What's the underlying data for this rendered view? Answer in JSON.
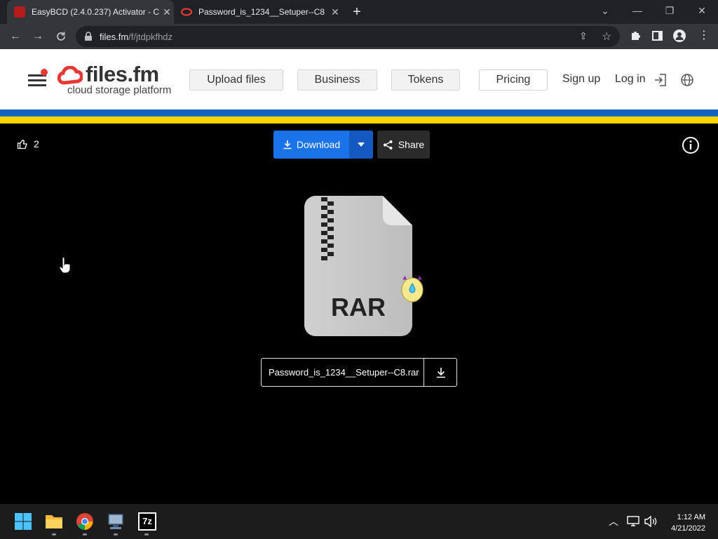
{
  "browser": {
    "tabs": [
      {
        "title": "EasyBCD (2.4.0.237) Activator - C",
        "active": true
      },
      {
        "title": "Password_is_1234__Setuper--C8",
        "active": false
      }
    ],
    "url_host": "files.fm",
    "url_path": "/f/jtdpkfhdz"
  },
  "site": {
    "logo_name": "files.fm",
    "logo_tagline": "cloud storage platform",
    "nav": {
      "upload": "Upload files",
      "business": "Business",
      "tokens": "Tokens",
      "pricing": "Pricing",
      "signup": "Sign up",
      "login": "Log in"
    },
    "flag_colors": [
      "#1565c0",
      "#ffd400"
    ]
  },
  "viewer": {
    "likes": "2",
    "download_label": "Download",
    "share_label": "Share",
    "file_type": "RAR",
    "file_name": "Password_is_1234__Setuper--C8.rar"
  },
  "taskbar": {
    "time": "1:12 AM",
    "date": "4/21/2022",
    "apps": [
      "windows-start-icon",
      "file-explorer-icon",
      "chrome-icon",
      "remote-desktop-icon",
      "7zip-icon"
    ]
  }
}
